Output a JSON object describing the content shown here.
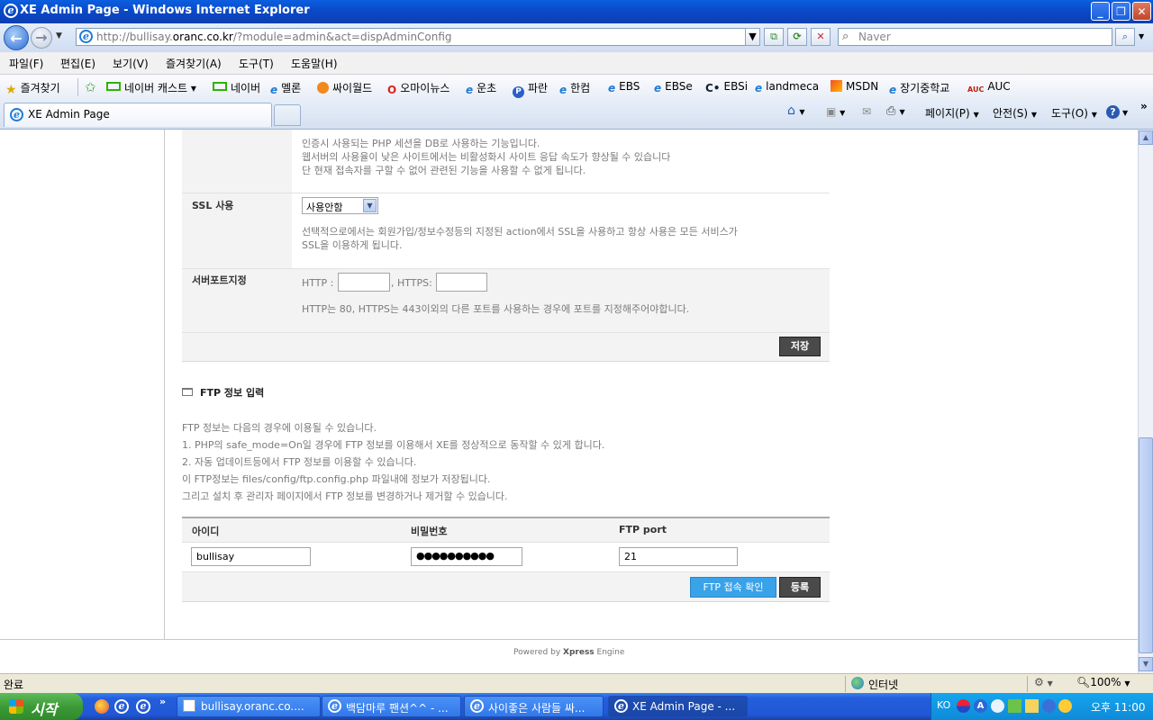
{
  "window": {
    "title": "XE Admin Page - Windows Internet Explorer"
  },
  "nav": {
    "url_prefix": "http://bullisay.",
    "url_domain": "oranc.co.kr",
    "url_suffix": "/?module=admin&act=dispAdminConfig",
    "search_placeholder": "Naver"
  },
  "menu": [
    "파일(F)",
    "편집(E)",
    "보기(V)",
    "즐겨찾기(A)",
    "도구(T)",
    "도움말(H)"
  ],
  "favorites": {
    "label": "즐겨찾기",
    "items": [
      "네이버 캐스트",
      "네이버",
      "멜론",
      "싸이월드",
      "오마이뉴스",
      "운초",
      "파란",
      "한컴",
      "EBS",
      "EBSe",
      "EBSi",
      "landmeca",
      "MSDN",
      "장기중학교",
      "AUC"
    ]
  },
  "tab": {
    "title": "XE Admin Page"
  },
  "toolbar": {
    "page": "페이지(P)",
    "safety": "안전(S)",
    "tools": "도구(O)"
  },
  "session_desc": [
    "인증시 사용되는 PHP 세션을 DB로 사용하는 기능입니다.",
    "웹서버의 사용율이 낮은 사이트에서는 비활성화시 사이트 응답 속도가 향상될 수 있습니다",
    "단 현재 접속자를 구할 수 없어 관련된 기능을 사용할 수 없게 됩니다."
  ],
  "ssl": {
    "label": "SSL 사용",
    "selected": "사용안함",
    "desc": [
      "선택적으로에서는 회원가입/정보수정등의 지정된 action에서 SSL을 사용하고 항상 사용은 모든 서비스가",
      "SSL을 이용하게 됩니다."
    ]
  },
  "ports": {
    "label": "서버포트지정",
    "http_label": "HTTP :",
    "https_label": ", HTTPS:",
    "desc": "HTTP는 80, HTTPS는 443이외의 다른 포트를 사용하는 경우에 포트를 지정해주어야합니다."
  },
  "save_label": "저장",
  "ftp": {
    "title": "FTP 정보 입력",
    "desc": [
      "FTP 정보는 다음의 경우에 이용될 수 있습니다.",
      "1. PHP의 safe_mode=On일 경우에 FTP 정보를 이용해서 XE를 정상적으로 동작할 수 있게 합니다.",
      "2. 자동 업데이트등에서 FTP 정보를 이용할 수 있습니다.",
      "이 FTP정보는 files/config/ftp.config.php 파일내에 정보가 저장됩니다.",
      "그리고 설치 후 관리자 페이지에서 FTP 정보를 변경하거나 제거할 수 있습니다."
    ],
    "col_id": "아이디",
    "col_pw": "비밀번호",
    "col_port": "FTP port",
    "id_value": "bullisay",
    "pw_value": "●●●●●●●●●●",
    "port_value": "21",
    "check_label": "FTP 접속 확인",
    "register_label": "등록"
  },
  "footer": {
    "powered_prefix": "Powered by ",
    "powered_brand": "Xpress",
    "powered_suffix": " Engine"
  },
  "status": {
    "left": "완료",
    "zone": "인터넷",
    "zoom": "100%"
  },
  "taskbar": {
    "start": "시작",
    "tasks": [
      "bullisay.oranc.co....",
      "백담마루 팬션^^ - ...",
      "사이좋은 사람들 싸...",
      "XE Admin Page - ..."
    ],
    "lang": "KO",
    "clock": "오후 11:00"
  }
}
